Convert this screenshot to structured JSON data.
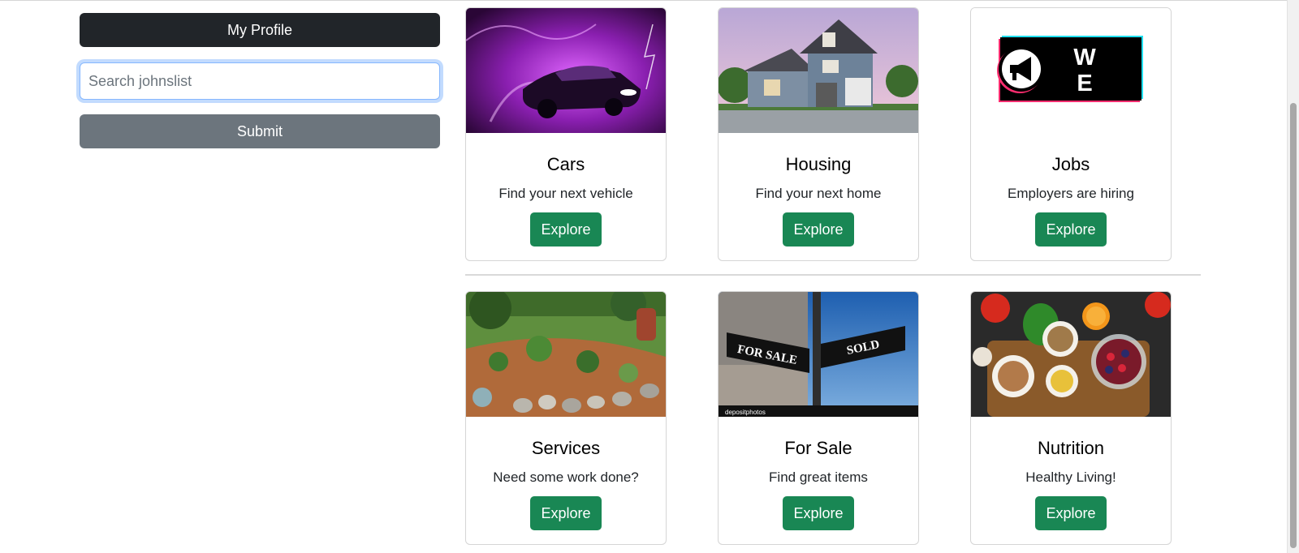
{
  "sidebar": {
    "profile_label": "My Profile",
    "search_placeholder": "Search johnslist",
    "submit_label": "Submit"
  },
  "cards": [
    {
      "title": "Cars",
      "text": "Find your next vehicle",
      "button": "Explore",
      "image": "purple-sports-car"
    },
    {
      "title": "Housing",
      "text": "Find your next home",
      "button": "Explore",
      "image": "two-story-house"
    },
    {
      "title": "Jobs",
      "text": "Employers are hiring",
      "button": "Explore",
      "image": "were-hiring-banner",
      "image_text": "WE'RE HIRING"
    },
    {
      "title": "Services",
      "text": "Need some work done?",
      "button": "Explore",
      "image": "landscaped-garden"
    },
    {
      "title": "For Sale",
      "text": "Find great items",
      "button": "Explore",
      "image": "for-sale-sold-street-signs",
      "image_text": [
        "FOR SALE",
        "SOLD",
        "depositphotos"
      ]
    },
    {
      "title": "Nutrition",
      "text": "Healthy Living!",
      "button": "Explore",
      "image": "healthy-food-bowls"
    }
  ],
  "colors": {
    "profile_button": "#212529",
    "submit_button": "#6c757d",
    "explore_button": "#198754",
    "focus_ring": "#86b7fe"
  }
}
